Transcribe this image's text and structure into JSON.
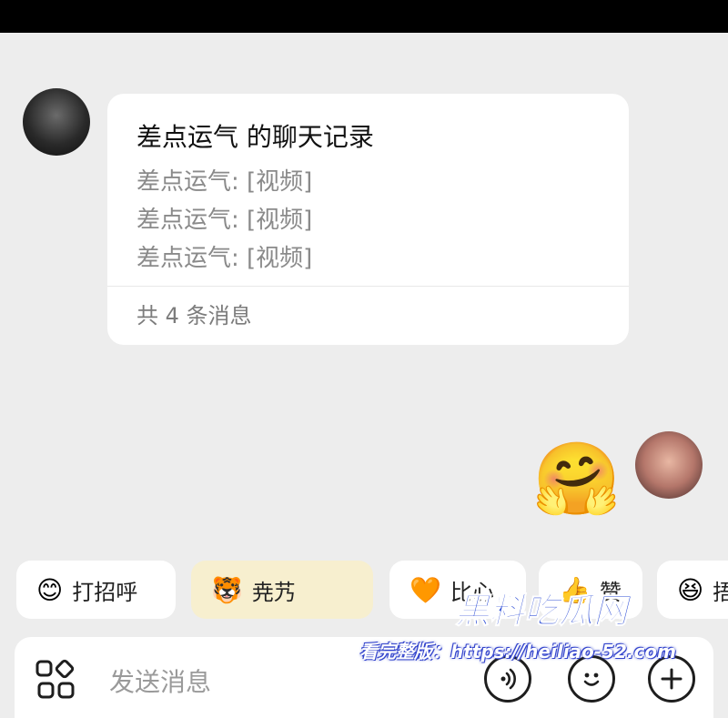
{
  "chat_record_card": {
    "title": "差点运气 的聊天记录",
    "lines": [
      "差点运气: [视频]",
      "差点运气: [视频]",
      "差点运气: [视频]"
    ],
    "footer": "共 4 条消息"
  },
  "sent_sticker": {
    "emoji": "🤗"
  },
  "quick_replies": [
    {
      "icon": "😊",
      "label": "打招呼"
    },
    {
      "icon": "🐯",
      "label": "尭艿"
    },
    {
      "icon": "🧡",
      "label": "比心"
    },
    {
      "icon": "👍",
      "label": "赞"
    },
    {
      "icon": "😆",
      "label": "捂"
    }
  ],
  "input_bar": {
    "placeholder": "发送消息"
  },
  "watermark": {
    "brand": "黑料吃瓜网",
    "url": "看完整版：https://heiliao-52.com"
  }
}
